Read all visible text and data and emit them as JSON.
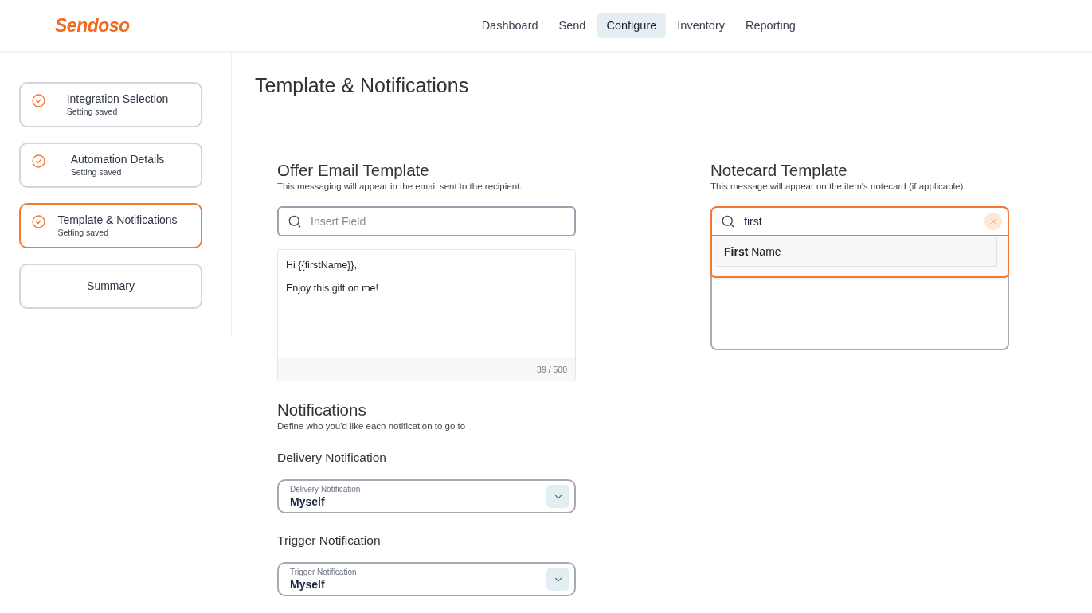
{
  "header": {
    "logo": "Sendoso",
    "nav": [
      {
        "label": "Dashboard",
        "selected": false
      },
      {
        "label": "Send",
        "selected": false
      },
      {
        "label": "Configure",
        "selected": true
      },
      {
        "label": "Inventory",
        "selected": false
      },
      {
        "label": "Reporting",
        "selected": false
      }
    ]
  },
  "sidebar": {
    "steps": [
      {
        "title": "Integration Selection",
        "status": "Setting saved",
        "completed": true,
        "selected": false
      },
      {
        "title": "Automation Details",
        "status": "Setting saved",
        "completed": true,
        "selected": false
      },
      {
        "title": "Template & Notifications",
        "status": "Setting saved",
        "completed": true,
        "selected": true
      },
      {
        "title": "Summary",
        "completed": false,
        "selected": false
      }
    ]
  },
  "page_title": "Template & Notifications",
  "offer_email": {
    "title": "Offer Email Template",
    "subtitle": "This messaging will appear in the email sent to the recipient.",
    "insert_field": {
      "placeholder": "Insert Field",
      "focused": false
    },
    "message": {
      "lines": [
        "Hi {{firstName}},",
        "Enjoy this gift on me!"
      ],
      "counter": "39 / 500"
    }
  },
  "notifications": {
    "title": "Notifications",
    "subtitle": "Define who you'd like each notification to go to",
    "items": [
      {
        "heading": "Delivery Notification",
        "label": "Delivery Notification",
        "value": "Myself"
      },
      {
        "heading": "Trigger Notification",
        "label": "Trigger Notification",
        "value": "Myself"
      }
    ]
  },
  "notecard": {
    "title": "Notecard Template",
    "subtitle": "This message will appear on the item's notecard (if applicable).",
    "insert_field": {
      "value": "first",
      "focused": true
    },
    "suggestions": [
      {
        "label": "**First** Name"
      }
    ]
  }
}
